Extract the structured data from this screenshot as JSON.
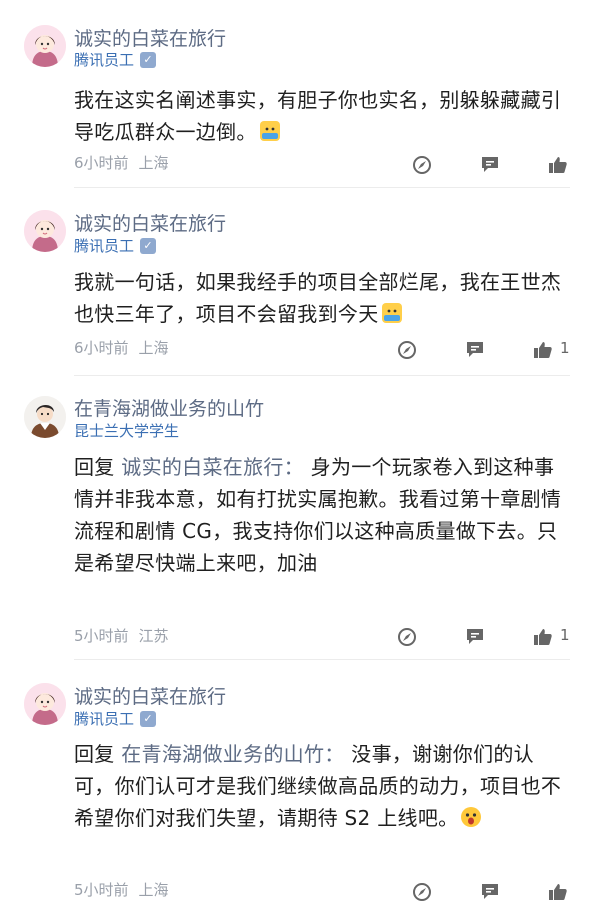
{
  "comments": [
    {
      "author": "诚实的白菜在旅行",
      "subtitle": "腾讯员工",
      "reply_prefix": "",
      "reply_to": "",
      "text": "我在这实名阐述事实，有胆子你也实名，别躲躲藏藏引导吃瓜群众一边倒。",
      "emoji": "niu-cai-emoji",
      "time": "6小时前",
      "location": "上海",
      "likes": ""
    },
    {
      "author": "诚实的白菜在旅行",
      "subtitle": "腾讯员工",
      "reply_prefix": "",
      "reply_to": "",
      "text": "我就一句话，如果我经手的项目全部烂尾，我在王世杰也快三年了，项目不会留我到今天",
      "emoji": "niu-cai-emoji",
      "time": "6小时前",
      "location": "上海",
      "likes": "1"
    },
    {
      "author": "在青海湖做业务的山竹",
      "subtitle": "昆士兰大学学生",
      "reply_prefix": "回复",
      "reply_to": "诚实的白菜在旅行：",
      "text": "身为一个玩家卷入到这种事情并非我本意，如有打扰实属抱歉。我看过第十章剧情流程和剧情 CG，我支持你们以这种高质量做下去。只是希望尽快端上来吧，加油",
      "emoji": "",
      "time": "5小时前",
      "location": "江苏",
      "likes": "1"
    },
    {
      "author": "诚实的白菜在旅行",
      "subtitle": "腾讯员工",
      "reply_prefix": "回复",
      "reply_to": "在青海湖做业务的山竹：",
      "text": "没事，谢谢你们的认可，你们认可才是我们继续做高品质的动力，项目也不希望你们对我们失望，请期待 S2 上线吧。",
      "emoji": "shocked-face-emoji",
      "time": "5小时前",
      "location": "上海",
      "likes": ""
    }
  ],
  "icons": {
    "verify": "verified-check-icon",
    "share": "share-compass-icon",
    "reply": "comment-bubble-icon",
    "like": "thumbs-up-icon"
  },
  "colors": {
    "author": "#5d6b84",
    "subtitle": "#3b6fb3",
    "meta": "#9aa0aa",
    "icon": "#666666"
  }
}
